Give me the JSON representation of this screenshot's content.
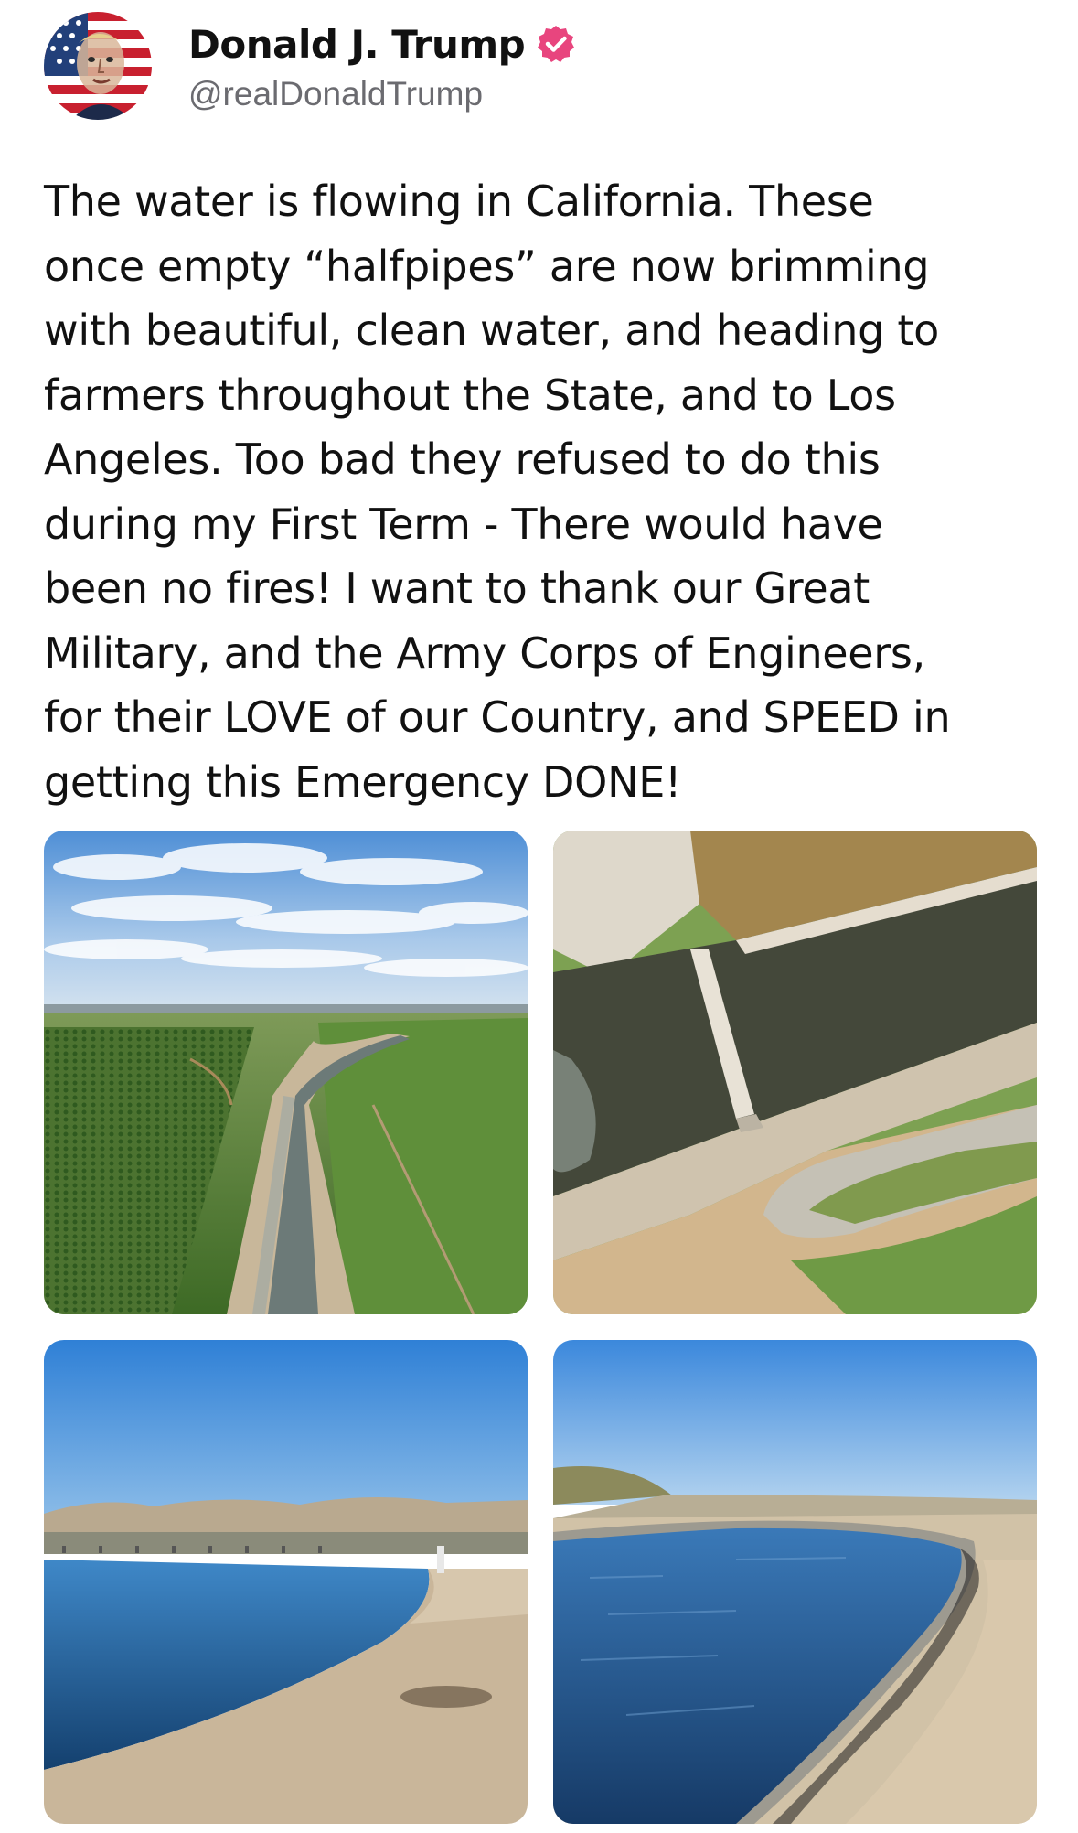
{
  "post": {
    "author": {
      "display_name": "Donald J. Trump",
      "handle": "@realDonaldTrump",
      "verified": true,
      "verified_badge_color": "#e8457e",
      "avatar_icon": "flag-portrait-avatar"
    },
    "text": "The water is flowing in California. These\nonce empty “halfpipes” are now brimming\nwith beautiful, clean water, and heading to\nfarmers throughout the State, and to Los\nAngeles. Too bad they refused to do this\nduring my First Term - There would have\nbeen no fires! I want to thank our Great\nMilitary, and the Army Corps of Engineers,\nfor their LOVE of our Country, and SPEED in\ngetting this Emergency DONE!",
    "media": [
      {
        "description_icon": "aerial-aqueduct-photo"
      },
      {
        "description_icon": "canal-bridge-photo"
      },
      {
        "description_icon": "reservoir-photo"
      },
      {
        "description_icon": "canal-curve-photo"
      }
    ]
  },
  "colors": {
    "text": "#111111",
    "handle": "#6b6b70",
    "verified": "#e8457e"
  }
}
